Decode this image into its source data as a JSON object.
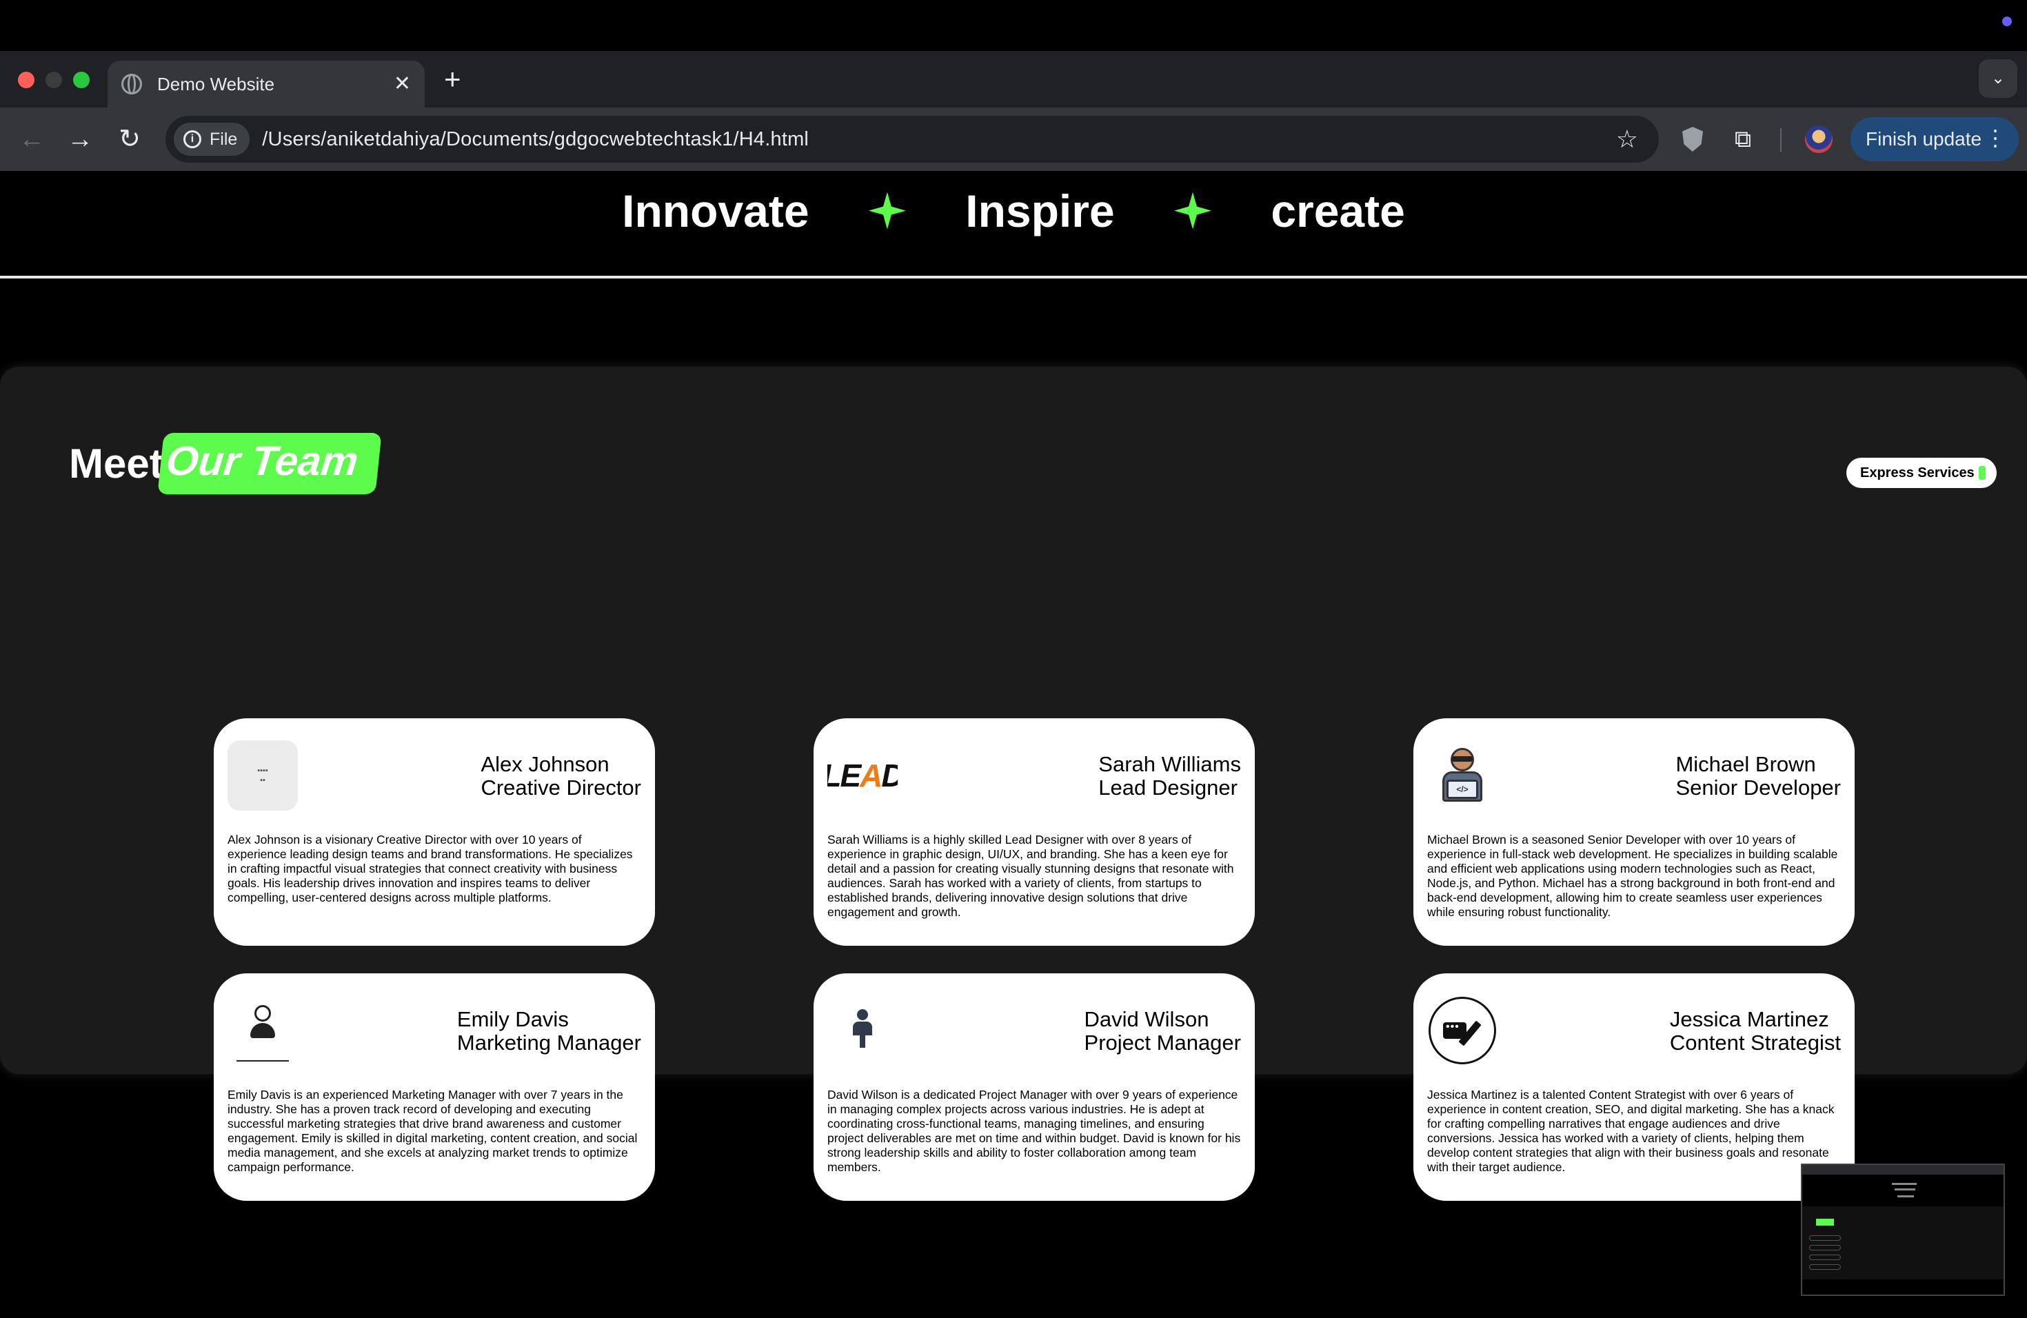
{
  "browser": {
    "tab_title": "Demo Website",
    "tab_close": "✕",
    "new_tab": "+",
    "tab_menu": "⌄",
    "back": "←",
    "forward": "→",
    "reload": "↻",
    "file_chip": "File",
    "info_glyph": "i",
    "url": "/Users/aniketdahiya/Documents/gdgocwebtechtask1/H4.html",
    "star": "☆",
    "puzzle": "⧉",
    "finish_update": "Finish update",
    "finish_menu": "⋮"
  },
  "marquee": {
    "words": [
      "Innovate",
      "Inspire",
      "create"
    ]
  },
  "team": {
    "meet": "Meet",
    "our_team": "Our Team",
    "express_services": "Express Services"
  },
  "avatars": {
    "lead_logo_a": "LE",
    "lead_logo_b": "A",
    "lead_logo_c": "D",
    "dev_code": "</>"
  },
  "members": [
    {
      "name": "Alex Johnson",
      "role": "Creative Director",
      "bio": "Alex Johnson is a visionary Creative Director with over 10 years of experience leading design teams and brand transformations. He specializes in crafting impactful visual strategies that connect creativity with business goals. His leadership drives innovation and inspires teams to deliver compelling, user-centered designs across multiple platforms."
    },
    {
      "name": "Sarah Williams",
      "role": "Lead Designer",
      "bio": "Sarah Williams is a highly skilled Lead Designer with over 8 years of experience in graphic design, UI/UX, and branding. She has a keen eye for detail and a passion for creating visually stunning designs that resonate with audiences. Sarah has worked with a variety of clients, from startups to established brands, delivering innovative design solutions that drive engagement and growth."
    },
    {
      "name": "Michael Brown",
      "role": "Senior Developer",
      "bio": "Michael Brown is a seasoned Senior Developer with over 10 years of experience in full-stack web development. He specializes in building scalable and efficient web applications using modern technologies such as React, Node.js, and Python. Michael has a strong background in both front-end and back-end development, allowing him to create seamless user experiences while ensuring robust functionality."
    },
    {
      "name": "Emily Davis",
      "role": "Marketing Manager",
      "bio": "Emily Davis is an experienced Marketing Manager with over 7 years in the industry. She has a proven track record of developing and executing successful marketing strategies that drive brand awareness and customer engagement. Emily is skilled in digital marketing, content creation, and social media management, and she excels at analyzing market trends to optimize campaign performance."
    },
    {
      "name": "David Wilson",
      "role": "Project Manager",
      "bio": "David Wilson is a dedicated Project Manager with over 9 years of experience in managing complex projects across various industries. He is adept at coordinating cross-functional teams, managing timelines, and ensuring project deliverables are met on time and within budget. David is known for his strong leadership skills and ability to foster collaboration among team members."
    },
    {
      "name": "Jessica Martinez",
      "role": "Content Strategist",
      "bio": "Jessica Martinez is a talented Content Strategist with over 6 years of experience in content creation, SEO, and digital marketing. She has a knack for crafting compelling narratives that engage audiences and drive conversions. Jessica has worked with a variety of clients, helping them develop content strategies that align with their business goals and resonate with their target audience."
    }
  ],
  "colors": {
    "accent_green": "#5dfb4b",
    "panel": "#1b1b1b",
    "card": "#ffffff",
    "chrome_dark": "#202124",
    "chrome_toolbar": "#35363a",
    "update_button": "#1f4a7a"
  },
  "icons": {
    "tab_favicon": "globe-icon",
    "omnibox_info": "info-icon",
    "bookmark": "star-icon",
    "extension_shield": "shield-icon",
    "extensions": "puzzle-icon",
    "marquee_separator": "sparkle-icon"
  }
}
